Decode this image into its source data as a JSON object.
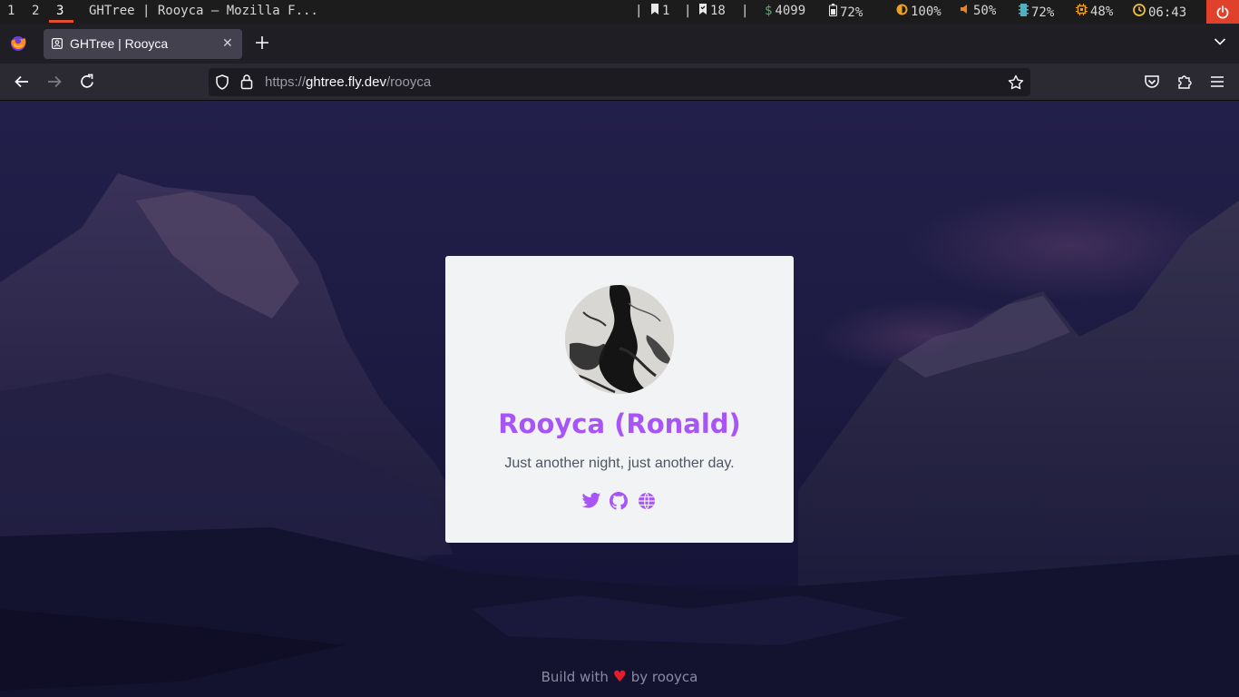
{
  "system_bar": {
    "workspaces": [
      "1",
      "2",
      "3"
    ],
    "active_workspace": "3",
    "window_title": "GHTree | Rooyca — Mozilla F...",
    "separator": "|",
    "bookmarks_count": "1",
    "tasks_count": "18",
    "money": "4099",
    "battery": "72%",
    "brightness": "100%",
    "volume": "50%",
    "memory": "72%",
    "cpu": "48%",
    "clock": "06:43",
    "colors": {
      "money": "#3fbf5a",
      "brightness": "#f0a020",
      "volume": "#f08020",
      "memory": "#4fb0c0",
      "cpu": "#f0a020",
      "clock": "#f0c040",
      "power": "#e0412a"
    }
  },
  "browser": {
    "tab": {
      "title": "GHTree | Rooyca"
    },
    "url": {
      "scheme": "https://",
      "host": "ghtree.fly.dev",
      "path": "/rooyca"
    }
  },
  "profile": {
    "name": "Rooyca (Ronald)",
    "bio": "Just another night, just another day.",
    "socials": [
      "twitter-icon",
      "github-icon",
      "globe-icon"
    ],
    "accent_color": "#a855f7"
  },
  "footer": {
    "prefix": "Build with",
    "heart": "♥",
    "suffix": "by rooyca"
  }
}
